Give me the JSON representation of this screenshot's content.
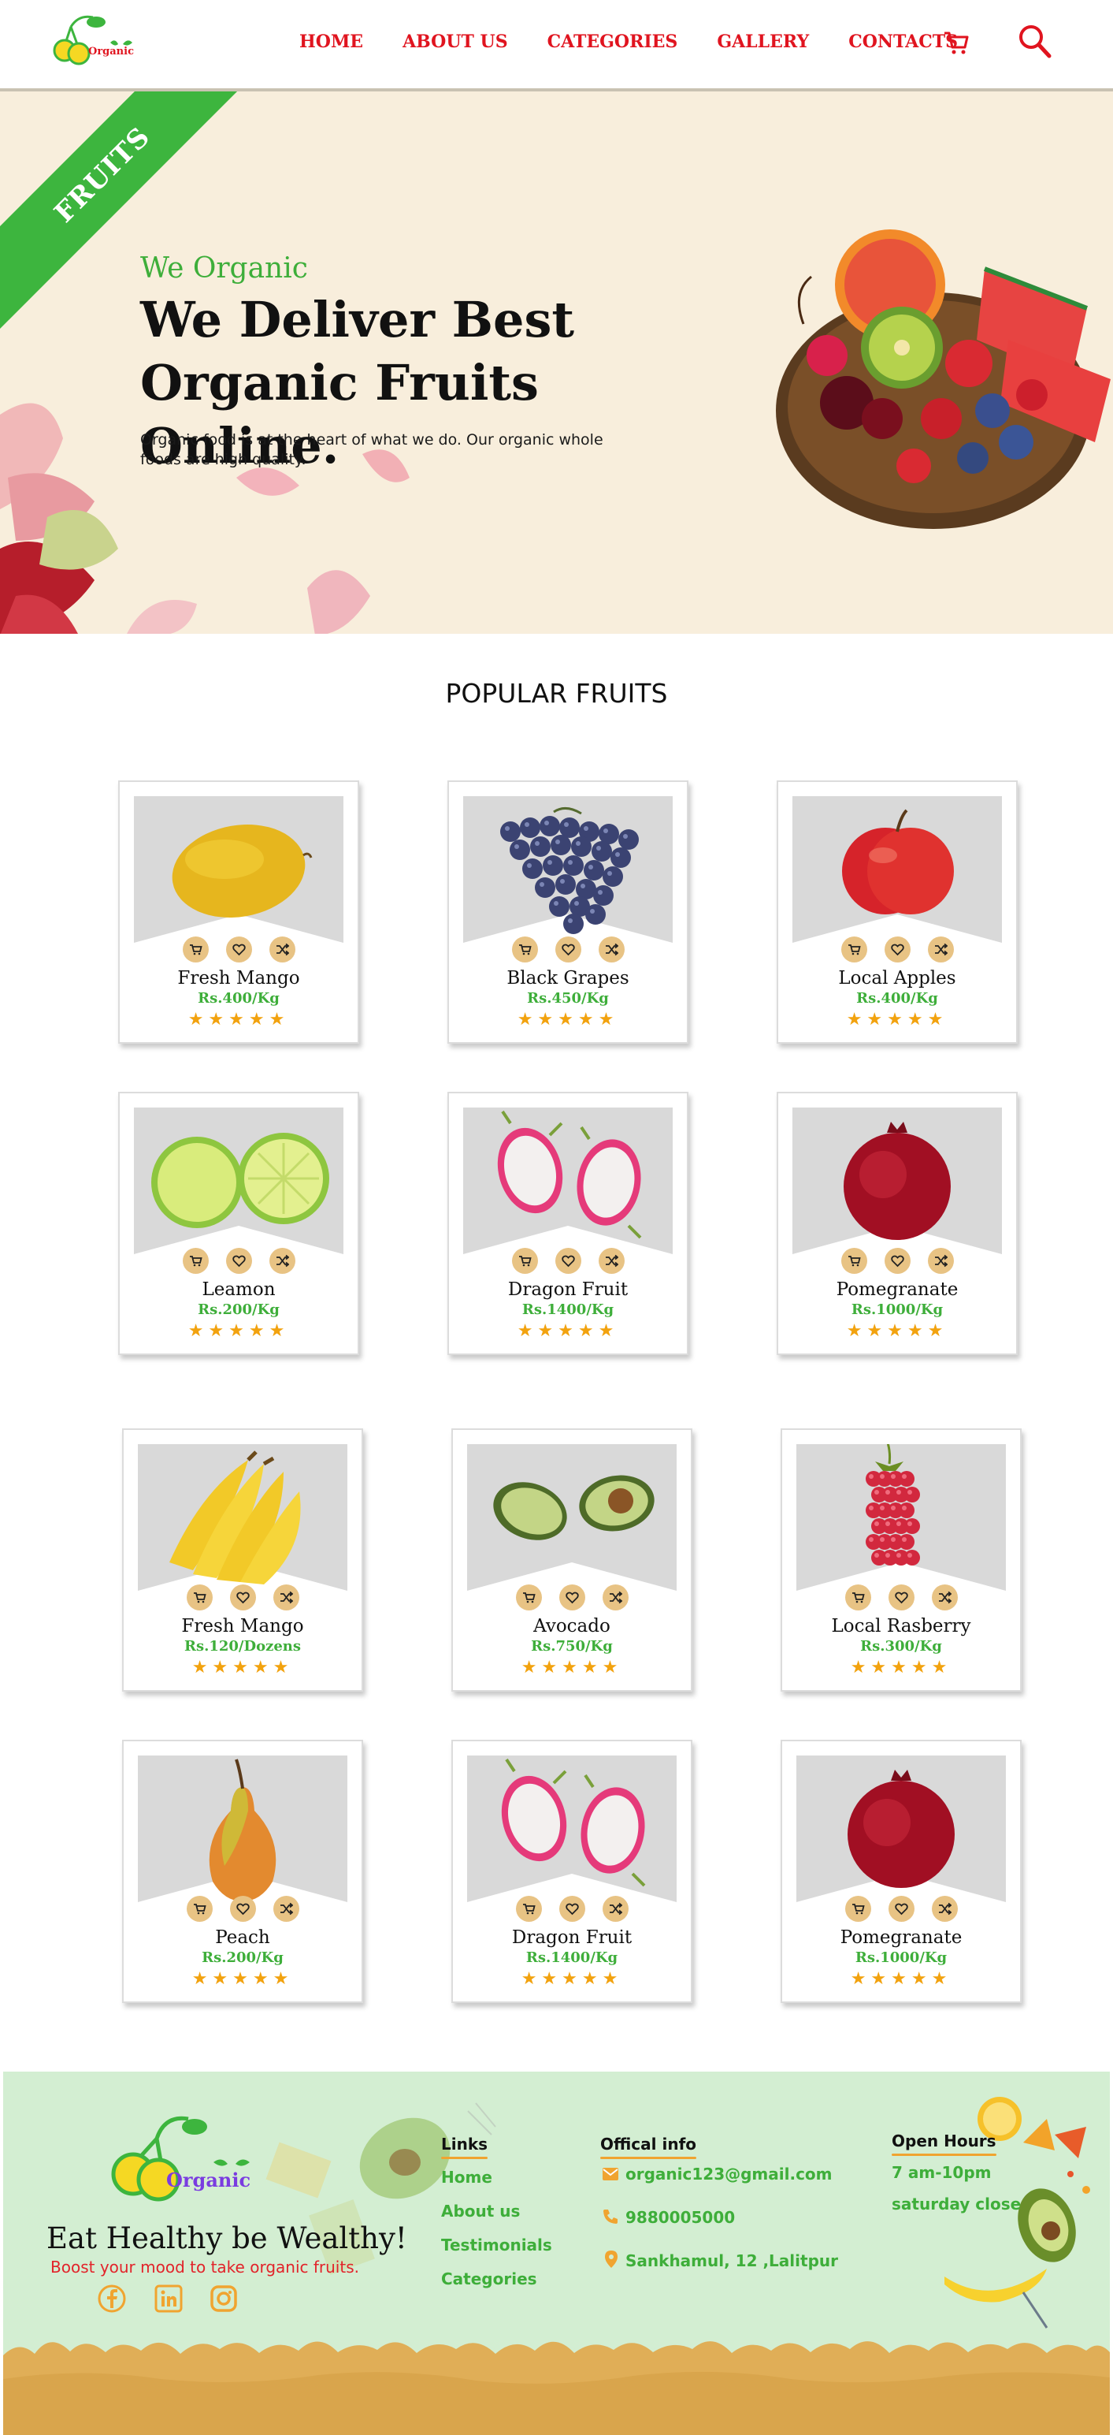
{
  "nav": {
    "logo_text": "Organic",
    "links": [
      "HOME",
      "ABOUT US",
      "CATEGORIES",
      "GALLERY",
      "CONTACTS"
    ],
    "cart_icon": "cart-icon",
    "search_icon": "search-icon"
  },
  "hero": {
    "ribbon": "FRUITS",
    "subtitle": "We Organic",
    "title": "We Deliver Best Organic Fruits Online.",
    "description": "Organic food is at the heart of what we do. Our organic whole foods are high quality."
  },
  "popular": {
    "title": "POPULAR FRUITS",
    "action_icons": [
      "cart-icon",
      "heart-icon",
      "shuffle-icon"
    ],
    "products": [
      {
        "name": "Fresh Mango",
        "price": "Rs.400/Kg",
        "rating": 5,
        "fruit": "mango"
      },
      {
        "name": "Black Grapes",
        "price": "Rs.450/Kg",
        "rating": 5,
        "fruit": "grapes"
      },
      {
        "name": "Local Apples",
        "price": "Rs.400/Kg",
        "rating": 5,
        "fruit": "apple"
      },
      {
        "name": "Leamon",
        "price": "Rs.200/Kg",
        "rating": 5,
        "fruit": "lemon"
      },
      {
        "name": "Dragon Fruit",
        "price": "Rs.1400/Kg",
        "rating": 5,
        "fruit": "dragon"
      },
      {
        "name": "Pomegranate",
        "price": "Rs.1000/Kg",
        "rating": 5,
        "fruit": "pomegranate"
      },
      {
        "name": "Fresh Mango",
        "price": "Rs.120/Dozens",
        "rating": 5,
        "fruit": "banana"
      },
      {
        "name": "Avocado",
        "price": "Rs.750/Kg",
        "rating": 5,
        "fruit": "avocado"
      },
      {
        "name": "Local Rasberry",
        "price": "Rs.300/Kg",
        "rating": 5,
        "fruit": "raspberry"
      },
      {
        "name": "Peach",
        "price": "Rs.200/Kg",
        "rating": 5,
        "fruit": "pear"
      },
      {
        "name": "Dragon Fruit",
        "price": "Rs.1400/Kg",
        "rating": 5,
        "fruit": "dragon"
      },
      {
        "name": "Pomegranate",
        "price": "Rs.1000/Kg",
        "rating": 5,
        "fruit": "pomegranate"
      }
    ]
  },
  "footer": {
    "logo_text": "Organic",
    "slogan": "Eat Healthy be Wealthy!",
    "tagline": "Boost your mood to take organic fruits.",
    "social": [
      "facebook-icon",
      "linkedin-icon",
      "instagram-icon"
    ],
    "links_title": "Links",
    "links": [
      "Home",
      "About us",
      "Testimonials",
      "Categories"
    ],
    "info_title": "Offical info",
    "email": "organic123@gmail.com",
    "phone": "9880005000",
    "address": "Sankhamul, 12 ,Lalitpur",
    "hours_title": "Open Hours",
    "hours": "7 am-10pm",
    "closed": "saturday close"
  },
  "colors": {
    "accent_red": "#e0141f",
    "green": "#3eae3a",
    "hero_bg": "#f8eedc",
    "footer_bg": "#d3eed2",
    "star": "#f2a20e",
    "action_bg": "#e8c384"
  }
}
